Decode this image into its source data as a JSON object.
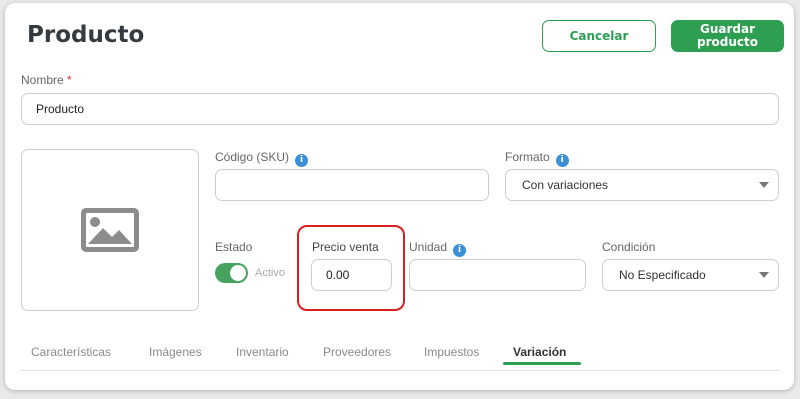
{
  "header": {
    "title": "Producto",
    "cancel_label": "Cancelar",
    "save_label": "Guardar\nproducto"
  },
  "form": {
    "nombre": {
      "label": "Nombre",
      "required_mark": "*",
      "value": "Producto"
    },
    "sku": {
      "label": "Código (SKU)",
      "value": ""
    },
    "formato": {
      "label": "Formato",
      "selected": "Con variaciones"
    },
    "estado": {
      "label": "Estado",
      "toggle_text": "Activo",
      "on": true
    },
    "precio_venta": {
      "label": "Precio venta",
      "value": "0.00"
    },
    "unidad": {
      "label": "Unidad",
      "value": ""
    },
    "condicion": {
      "label": "Condición",
      "selected": "No Especificado"
    }
  },
  "tabs": [
    {
      "label": "Características"
    },
    {
      "label": "Imágenes"
    },
    {
      "label": "Inventario"
    },
    {
      "label": "Proveedores"
    },
    {
      "label": "Impuestos"
    },
    {
      "label": "Variación",
      "active": true
    }
  ],
  "icons": {
    "info": "info-icon",
    "image_placeholder": "image-placeholder-icon",
    "caret": "chevron-down-icon"
  },
  "colors": {
    "brand_green": "#2e9e52",
    "highlight_red": "#d9201e",
    "info_blue": "#3a8fd6"
  }
}
